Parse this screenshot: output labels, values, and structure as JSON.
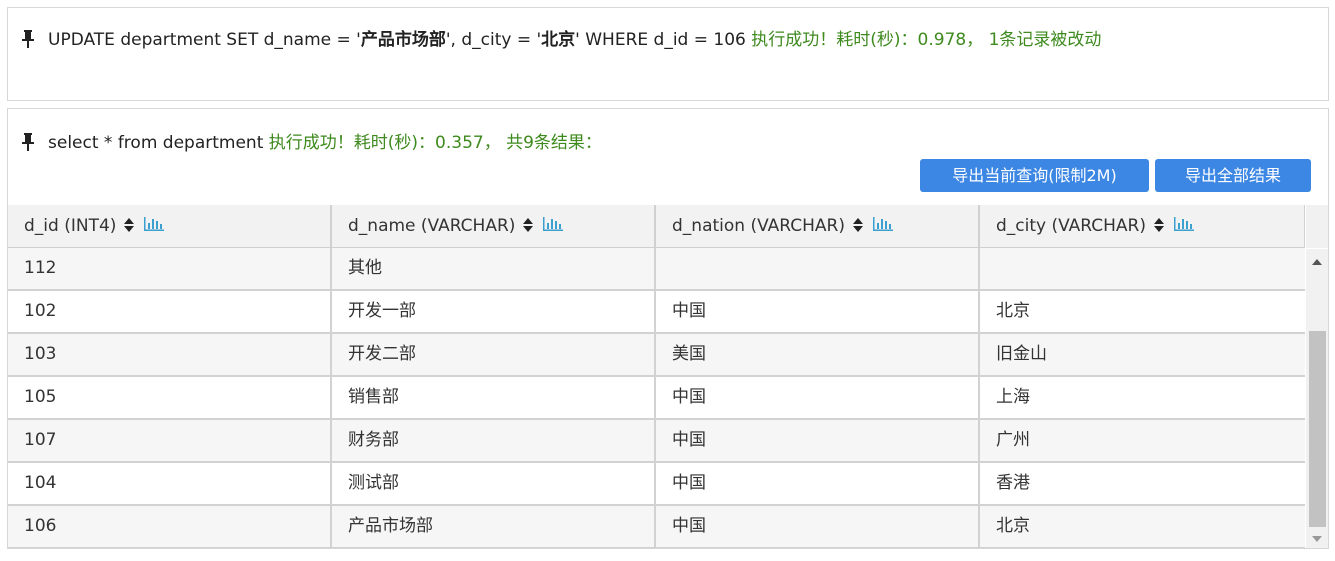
{
  "update_result": {
    "sql_prefix": "UPDATE department SET d_name = '",
    "sql_value1": "产品市场部",
    "sql_mid": "', d_city = '",
    "sql_value2": "北京",
    "sql_suffix": "' WHERE d_id = 106",
    "status": " 执行成功！耗时(秒)：0.978， 1条记录被改动"
  },
  "select_result": {
    "sql": "select * from department",
    "status": " 执行成功！耗时(秒)：0.357， 共9条结果："
  },
  "buttons": {
    "export_current": "导出当前查询(限制2M)",
    "export_all": "导出全部结果"
  },
  "table": {
    "columns": [
      {
        "label": "d_id (INT4)"
      },
      {
        "label": "d_name (VARCHAR)"
      },
      {
        "label": "d_nation (VARCHAR)"
      },
      {
        "label": "d_city (VARCHAR)"
      }
    ],
    "rows": [
      [
        "112",
        "其他",
        "",
        ""
      ],
      [
        "102",
        "开发一部",
        "中国",
        "北京"
      ],
      [
        "103",
        "开发二部",
        "美国",
        "旧金山"
      ],
      [
        "105",
        "销售部",
        "中国",
        "上海"
      ],
      [
        "107",
        "财务部",
        "中国",
        "广州"
      ],
      [
        "104",
        "测试部",
        "中国",
        "香港"
      ],
      [
        "106",
        "产品市场部",
        "中国",
        "北京"
      ]
    ]
  },
  "icons": {
    "pin": "pin-icon",
    "sort": "sort-icon",
    "chart": "bar-chart-icon"
  },
  "colors": {
    "success_text": "#3e8a1e",
    "button_bg": "#3c86e4",
    "chart_icon": "#3b9fd0"
  }
}
